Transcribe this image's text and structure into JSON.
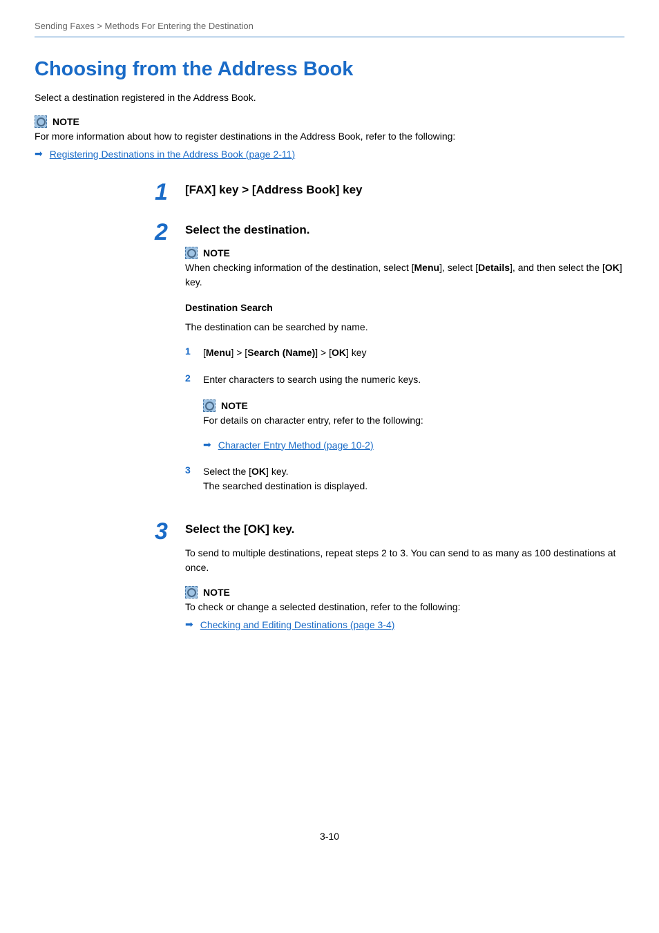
{
  "breadcrumb": "Sending Faxes > Methods For Entering the Destination",
  "main_title": "Choosing from the Address Book",
  "intro": "Select a destination registered in the Address Book.",
  "note1": {
    "label": "NOTE",
    "text": "For more information about how to register destinations in the Address Book, refer to the following:",
    "link": "Registering Destinations in the Address Book (page 2-11)"
  },
  "step1": {
    "num": "1",
    "title": "[FAX] key > [Address Book] key"
  },
  "step2": {
    "num": "2",
    "title": "Select the destination.",
    "note": {
      "label": "NOTE",
      "prefix": "When checking information of the destination, select [",
      "menu": "Menu",
      "mid1": "], select [",
      "details": "Details",
      "mid2": "], and then select the [",
      "ok": "OK",
      "suffix": "] key."
    },
    "search_heading": "Destination Search",
    "search_desc": "The destination can be searched by name.",
    "item1": {
      "num": "1",
      "b1": "[",
      "menu": "Menu",
      "b2": "] > [",
      "search": "Search (Name)",
      "b3": "] > [",
      "ok": "OK",
      "b4": "] key"
    },
    "item2": {
      "num": "2",
      "text": "Enter characters to search using the numeric keys."
    },
    "inner_note": {
      "label": "NOTE",
      "text": "For details on character entry, refer to the following:",
      "link": "Character Entry Method (page 10-2)"
    },
    "item3": {
      "num": "3",
      "line1_a": "Select the [",
      "line1_ok": "OK",
      "line1_b": "] key.",
      "line2": "The searched destination is displayed."
    }
  },
  "step3": {
    "num": "3",
    "title": "Select the [OK] key.",
    "desc": "To send to multiple destinations, repeat steps 2 to 3. You can send to as many as 100 destinations at once.",
    "note": {
      "label": "NOTE",
      "text": "To check or change a selected destination, refer to the following:",
      "link": "Checking and Editing Destinations (page 3-4)"
    }
  },
  "page_number": "3-10"
}
